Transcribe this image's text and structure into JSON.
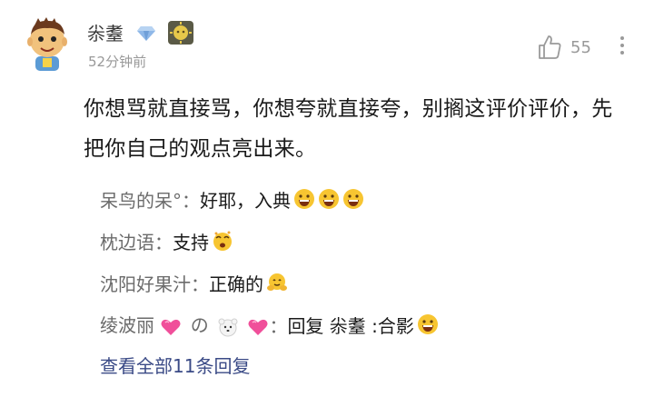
{
  "comment": {
    "username": "尜耋",
    "timestamp": "52分钟前",
    "like_count": "55",
    "text": "你想骂就直接骂，你想夸就直接夸，别搁这评价评价，先把你自己的观点亮出来。"
  },
  "replies": [
    {
      "name": "呆鸟的呆°",
      "colon": "：",
      "text": "好耶，入典",
      "emojis": [
        "grin-emoji",
        "grin-emoji",
        "grin-emoji"
      ]
    },
    {
      "name": "枕边语",
      "colon": "：",
      "text": "支持",
      "emojis": [
        "dizzy-emoji"
      ]
    },
    {
      "name": "沈阳好果汁",
      "colon": "：",
      "text": "正确的",
      "emojis": [
        "hug-emoji"
      ]
    },
    {
      "name_parts": [
        "绫波丽",
        "の",
        ""
      ],
      "colon": "：",
      "text": "回复 尜耋 :合影",
      "emojis": [
        "grin-emoji"
      ]
    }
  ],
  "view_all": "查看全部11条回复"
}
